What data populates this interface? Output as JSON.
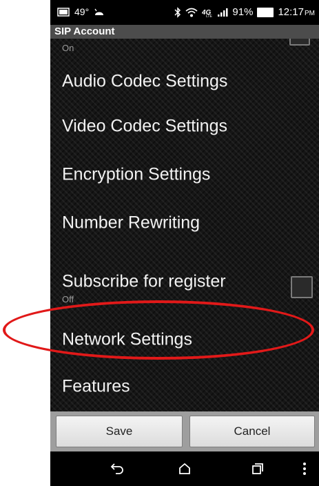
{
  "status_bar": {
    "temperature": "49°",
    "battery_percent": "91%",
    "time": "12:17",
    "time_suffix": "PM",
    "icons": [
      "weather-icon",
      "android-robot-icon",
      "bluetooth-icon",
      "wifi-icon",
      "lte-icon",
      "signal-icon",
      "battery-icon"
    ]
  },
  "title_bar": {
    "title": "SIP Account"
  },
  "settings": {
    "top_partial": {
      "summary": "On"
    },
    "items": [
      {
        "label": "Audio Codec Settings"
      },
      {
        "label": "Video Codec Settings"
      },
      {
        "label": "Encryption Settings"
      },
      {
        "label": "Number Rewriting"
      },
      {
        "label": "Subscribe for register",
        "summary": "Off",
        "checked": false
      },
      {
        "label": "Network Settings"
      },
      {
        "label": "Features"
      }
    ]
  },
  "buttons": {
    "save": "Save",
    "cancel": "Cancel"
  },
  "nav_bar": {
    "icons": [
      "back-icon",
      "home-icon",
      "recent-apps-icon",
      "overflow-menu-icon"
    ]
  },
  "annotation": {
    "color": "#e11919",
    "highlight_target": "Network Settings"
  }
}
